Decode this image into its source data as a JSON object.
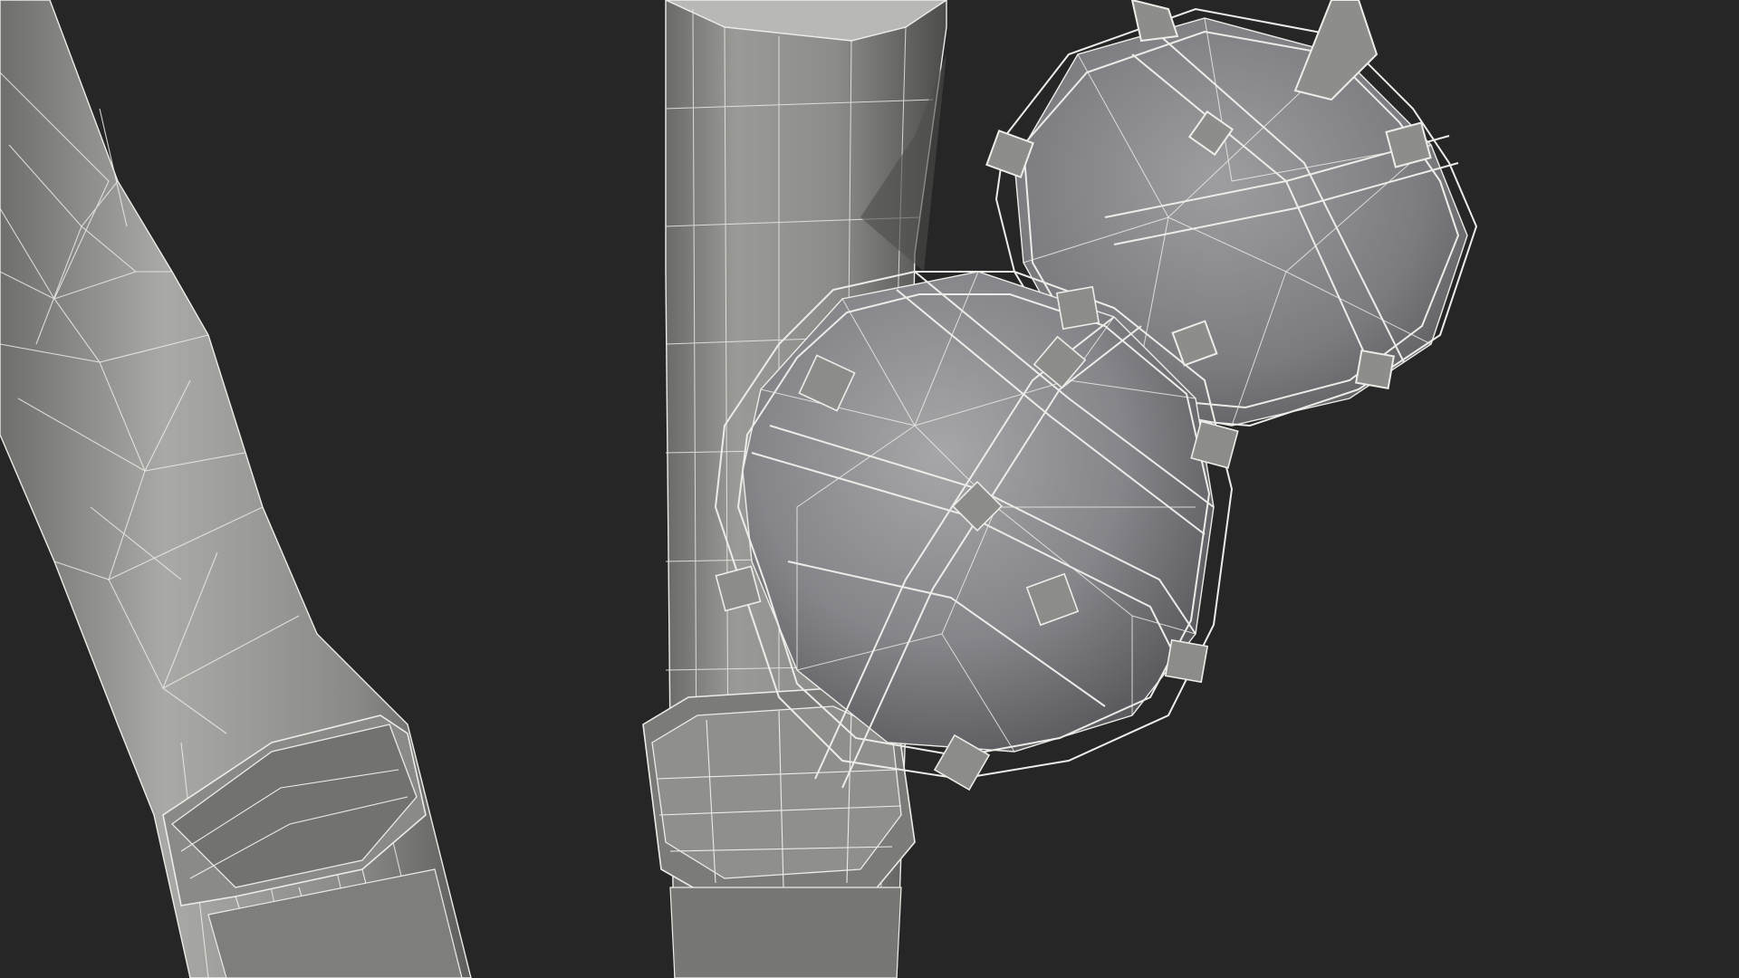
{
  "scene": {
    "background_color": "#262626",
    "mesh_color": "#8e8e8a",
    "mesh_highlight_color": "#b9b9b5",
    "mesh_shadow_color": "#5c5c5a",
    "wireframe_color": "#ecece8",
    "objects": [
      "left-staff-shaft",
      "left-staff-binding",
      "center-staff-shaft",
      "center-staff-binding",
      "large-netted-orb",
      "small-netted-orb"
    ]
  }
}
